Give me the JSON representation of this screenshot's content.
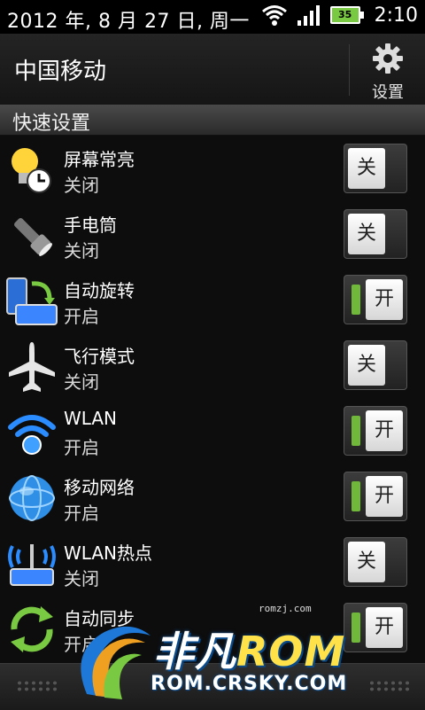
{
  "status_bar": {
    "date": "2012 年, 8 月 27 日, 周一",
    "battery": "35",
    "time": "2:10"
  },
  "header": {
    "title": "中国移动",
    "settings_label": "设置",
    "settings_icon": "gear-icon"
  },
  "section": {
    "title": "快速设置"
  },
  "rows": [
    {
      "title": "屏幕常亮",
      "status": "关闭",
      "toggle": "关",
      "state": "off",
      "icon": "bulb-clock-icon"
    },
    {
      "title": "手电筒",
      "status": "关闭",
      "toggle": "关",
      "state": "off",
      "icon": "flashlight-icon"
    },
    {
      "title": "自动旋转",
      "status": "开启",
      "toggle": "开",
      "state": "on",
      "icon": "rotate-icon"
    },
    {
      "title": "飞行模式",
      "status": "关闭",
      "toggle": "关",
      "state": "off",
      "icon": "airplane-icon"
    },
    {
      "title": "WLAN",
      "status": "开启",
      "toggle": "开",
      "state": "on",
      "icon": "wifi-icon"
    },
    {
      "title": "移动网络",
      "status": "开启",
      "toggle": "开",
      "state": "on",
      "icon": "globe-icon"
    },
    {
      "title": "WLAN热点",
      "status": "关闭",
      "toggle": "关",
      "state": "off",
      "icon": "hotspot-icon"
    },
    {
      "title": "自动同步",
      "status": "开启",
      "toggle": "开",
      "state": "on",
      "icon": "sync-icon"
    }
  ],
  "watermark": {
    "small": "romzj.com",
    "brand_a": "非凡",
    "brand_b": "ROM",
    "url": "ROM.CRSKY.COM"
  },
  "colors": {
    "on_green": "#6fb83a",
    "background": "#0d0d0d"
  }
}
